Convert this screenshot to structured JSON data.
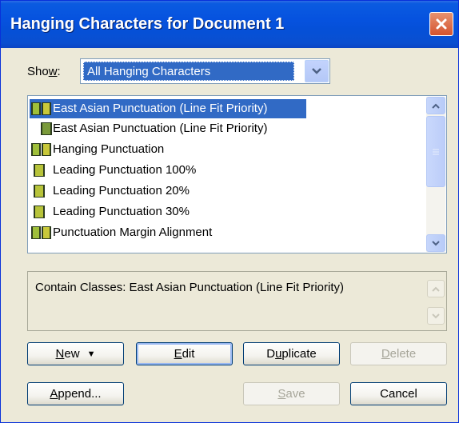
{
  "window": {
    "title": "Hanging Characters for Document 1"
  },
  "show": {
    "label_before": "Sho",
    "label_mnemonic": "w",
    "label_after": ":",
    "selected": "All Hanging Characters"
  },
  "list": {
    "items": [
      {
        "label": "East Asian Punctuation (Line Fit Priority)",
        "icon": "double-bar-icon"
      },
      {
        "label": "East Asian Punctuation (Line Fit Priority)",
        "icon": "single-bar-icon"
      },
      {
        "label": "Hanging Punctuation",
        "icon": "double-bar-icon"
      },
      {
        "label": "Leading Punctuation 100%",
        "icon": "single-bar-icon"
      },
      {
        "label": "Leading Punctuation 20%",
        "icon": "single-bar-icon"
      },
      {
        "label": "Leading Punctuation 30%",
        "icon": "single-bar-icon"
      },
      {
        "label": "Punctuation Margin Alignment",
        "icon": "double-bar-icon"
      }
    ],
    "selected_index": 0
  },
  "description": {
    "text": "Contain Classes: East Asian Punctuation (Line Fit Priority)"
  },
  "buttons": {
    "new": {
      "mnemonic": "N",
      "rest": "ew",
      "arrow": "▼"
    },
    "edit": {
      "mnemonic": "E",
      "rest": "dit"
    },
    "duplicate": {
      "before": "D",
      "mnemonic": "u",
      "rest": "plicate"
    },
    "delete": {
      "mnemonic": "D",
      "rest": "elete"
    },
    "append": {
      "mnemonic": "A",
      "rest": "ppend..."
    },
    "save": {
      "mnemonic": "S",
      "rest": "ave"
    },
    "cancel": {
      "label": "Cancel"
    }
  },
  "colors": {
    "title_bar": "#0652df",
    "selection": "#316ac5",
    "dialog_bg": "#ece9d8"
  }
}
